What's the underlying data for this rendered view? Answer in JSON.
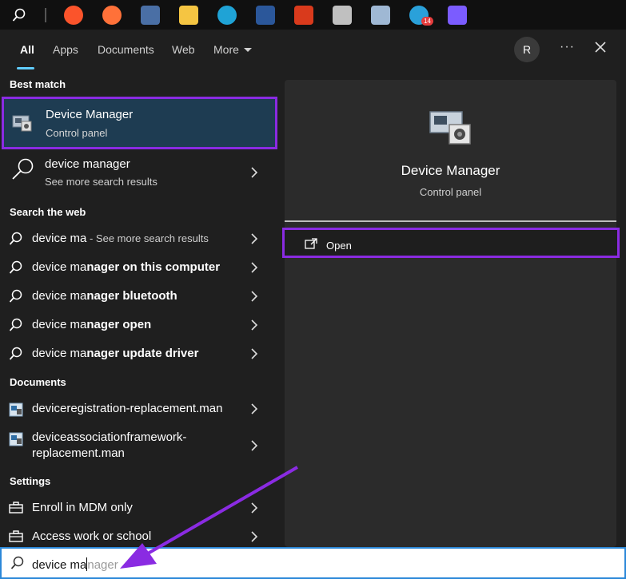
{
  "taskbar": {
    "icons": [
      {
        "name": "brave-icon",
        "color": "#fb542b"
      },
      {
        "name": "firefox-icon",
        "color": "#ff7139"
      },
      {
        "name": "calculator-icon",
        "color": "#4a6fa5"
      },
      {
        "name": "file-explorer-icon",
        "color": "#f5c542"
      },
      {
        "name": "edge-icon",
        "color": "#1fa3d6"
      },
      {
        "name": "word-icon",
        "color": "#2b579a"
      },
      {
        "name": "app-icon-globe",
        "color": "#d93a1c"
      },
      {
        "name": "app-icon-satellite",
        "color": "#c0c0c0"
      },
      {
        "name": "app-icon-chart",
        "color": "#9fb8d4"
      },
      {
        "name": "telegram-icon",
        "color": "#2aa1da"
      },
      {
        "name": "drop-icon",
        "color": "#7b5cff"
      }
    ],
    "telegram_badge": "14"
  },
  "tabs": [
    {
      "label": "All"
    },
    {
      "label": "Apps"
    },
    {
      "label": "Documents"
    },
    {
      "label": "Web"
    },
    {
      "label": "More"
    }
  ],
  "header": {
    "avatar_letter": "R",
    "more_options": "···"
  },
  "sections": {
    "best_match": "Best match",
    "search_web": "Search the web",
    "documents": "Documents",
    "settings": "Settings"
  },
  "best_match": {
    "title": "Device Manager",
    "subtitle": "Control panel"
  },
  "see_more": {
    "title": "device manager",
    "subtitle": "See more search results"
  },
  "web_results": [
    {
      "prefix": "device ma",
      "suffix": "",
      "dim": " - See more search results"
    },
    {
      "prefix": "device ma",
      "suffix": "nager on this computer",
      "dim": ""
    },
    {
      "prefix": "device ma",
      "suffix": "nager bluetooth",
      "dim": ""
    },
    {
      "prefix": "device ma",
      "suffix": "nager open",
      "dim": ""
    },
    {
      "prefix": "device ma",
      "suffix": "nager update driver",
      "dim": ""
    }
  ],
  "documents": [
    {
      "line1": "deviceregistration-replacement.man",
      "line2": ""
    },
    {
      "line1": "deviceassociationframework-",
      "line2": "replacement.man"
    }
  ],
  "settings": [
    {
      "label": "Enroll in MDM only"
    },
    {
      "label": "Access work or school"
    }
  ],
  "preview": {
    "title": "Device Manager",
    "subtitle": "Control panel",
    "open_label": "Open"
  },
  "search": {
    "typed": "device ma",
    "ghost": "nager"
  },
  "colors": {
    "highlight": "#8a2be2",
    "accent": "#60cdff",
    "selected": "#1e3c52"
  }
}
